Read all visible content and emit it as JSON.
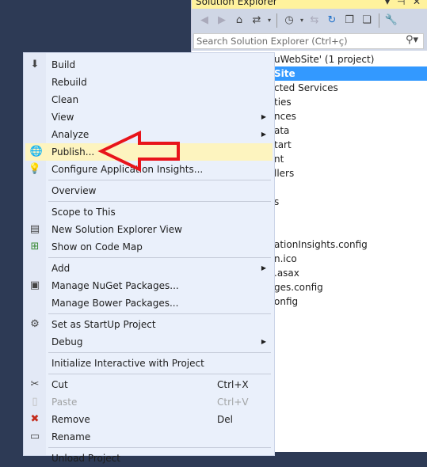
{
  "solution_explorer": {
    "title": "Solution Explorer",
    "search_placeholder": "Search Solution Explorer (Ctrl+ç)",
    "tree": [
      {
        "text": "uWebSite' (1 project)",
        "selected": false
      },
      {
        "text": "Site",
        "selected": true
      },
      {
        "text": "cted Services"
      },
      {
        "text": "ties"
      },
      {
        "text": "nces"
      },
      {
        "text": "ata"
      },
      {
        "text": "tart"
      },
      {
        "text": "nt"
      },
      {
        "text": "llers"
      },
      {
        "text": ""
      },
      {
        "text": "s"
      },
      {
        "text": ""
      },
      {
        "text": ""
      },
      {
        "text": "ationInsights.config"
      },
      {
        "text": "n.ico"
      },
      {
        "text": ".asax"
      },
      {
        "text": "ges.config"
      },
      {
        "text": "onfig"
      }
    ]
  },
  "context_menu": {
    "items": [
      {
        "label": "Build",
        "icon": "build-icon"
      },
      {
        "label": "Rebuild"
      },
      {
        "label": "Clean"
      },
      {
        "label": "View",
        "submenu": true
      },
      {
        "label": "Analyze",
        "submenu": true
      },
      {
        "label": "Publish...",
        "icon": "publish-globe-icon",
        "highlighted": true
      },
      {
        "label": "Configure Application Insights...",
        "icon": "application-insights-icon"
      },
      {
        "separator": true
      },
      {
        "label": "Overview"
      },
      {
        "separator": true
      },
      {
        "label": "Scope to This"
      },
      {
        "label": "New Solution Explorer View",
        "icon": "new-view-icon"
      },
      {
        "label": "Show on Code Map",
        "icon": "code-map-icon"
      },
      {
        "separator": true
      },
      {
        "label": "Add",
        "submenu": true
      },
      {
        "label": "Manage NuGet Packages...",
        "icon": "nuget-icon"
      },
      {
        "label": "Manage Bower Packages..."
      },
      {
        "separator": true
      },
      {
        "label": "Set as StartUp Project",
        "icon": "gear-icon"
      },
      {
        "label": "Debug",
        "submenu": true
      },
      {
        "separator": true
      },
      {
        "label": "Initialize Interactive with Project"
      },
      {
        "separator": true
      },
      {
        "label": "Cut",
        "icon": "scissors-icon",
        "shortcut": "Ctrl+X"
      },
      {
        "label": "Paste",
        "icon": "paste-icon",
        "shortcut": "Ctrl+V",
        "disabled": true
      },
      {
        "label": "Remove",
        "icon": "remove-x-icon",
        "shortcut": "Del"
      },
      {
        "label": "Rename",
        "icon": "rename-icon"
      },
      {
        "separator": true
      },
      {
        "label": "Unload Project"
      }
    ]
  },
  "annotation": {
    "type": "red-arrow-pointing-left",
    "color": "#e8141b"
  },
  "colors": {
    "highlight": "#fdf4bf",
    "selection": "#3399ff",
    "title_bar": "#fff29d"
  }
}
